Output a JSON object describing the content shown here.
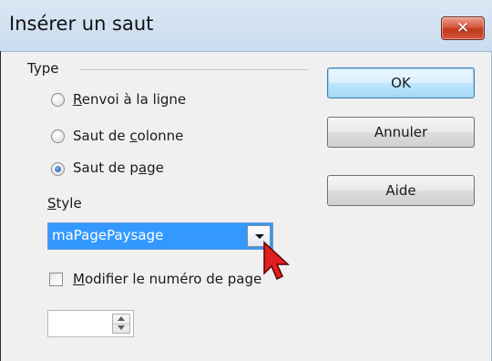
{
  "window": {
    "title": "Insérer un saut",
    "close_glyph": "✕"
  },
  "type_group": {
    "label": "Type",
    "options": [
      {
        "pre": "",
        "mnemonic": "R",
        "post": "envoi à la ligne",
        "checked": false
      },
      {
        "pre": "Saut de ",
        "mnemonic": "c",
        "post": "olonne",
        "checked": false
      },
      {
        "pre": "Saut de p",
        "mnemonic": "a",
        "post": "ge",
        "checked": true
      }
    ]
  },
  "style": {
    "label_mnemonic": "S",
    "label_rest": "tyle",
    "selected": "maPagePaysage"
  },
  "page_number": {
    "label_mnemonic": "M",
    "label_rest": "odifier le numéro de page",
    "checked": false,
    "value": ""
  },
  "buttons": {
    "ok": "OK",
    "cancel": "Annuler",
    "help": "Aide"
  },
  "colors": {
    "selection": "#3399ff",
    "cursor": "#e02020"
  }
}
